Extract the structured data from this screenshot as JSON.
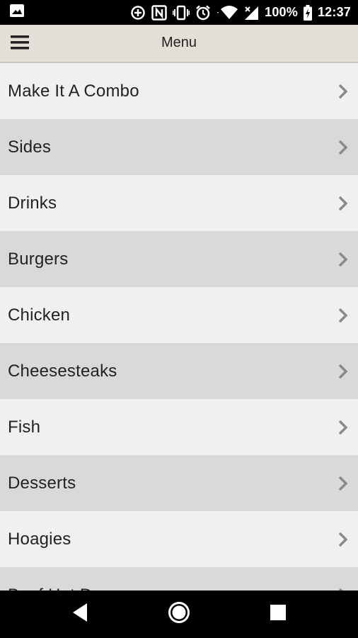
{
  "status_bar": {
    "battery_percent": "100%",
    "time": "12:37",
    "icons": [
      "image-icon",
      "data-saver-icon",
      "nfc-icon",
      "vibrate-icon",
      "alarm-icon",
      "wifi-icon",
      "cell-signal-icon",
      "battery-charging-icon"
    ]
  },
  "app_bar": {
    "title": "Menu",
    "menu_icon": "hamburger-icon"
  },
  "menu": {
    "items": [
      {
        "label": "Make It A Combo"
      },
      {
        "label": "Sides"
      },
      {
        "label": "Drinks"
      },
      {
        "label": "Burgers"
      },
      {
        "label": "Chicken"
      },
      {
        "label": "Cheesesteaks"
      },
      {
        "label": "Fish"
      },
      {
        "label": "Desserts"
      },
      {
        "label": "Hoagies"
      },
      {
        "label": "Beef Hot Dog"
      }
    ],
    "chevron_icon": "chevron-right-icon"
  },
  "nav_bar": {
    "icons": [
      "back-icon",
      "home-icon",
      "recents-icon"
    ]
  },
  "colors": {
    "app_bar_bg": "#e3dfd6",
    "row_light": "#f0f0f0",
    "row_dark": "#d9d9d9",
    "chevron": "#8a8a8a"
  }
}
